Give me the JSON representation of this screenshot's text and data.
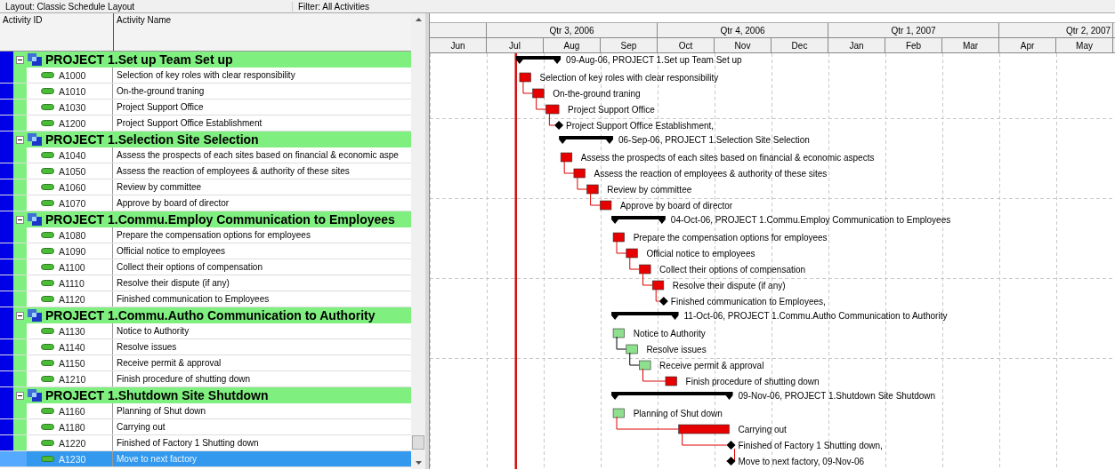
{
  "toolbar": {
    "layout": "Layout: Classic Schedule Layout",
    "filter": "Filter: All Activities"
  },
  "columns": [
    "Activity ID",
    "Activity Name"
  ],
  "timescale": {
    "quarters": [
      "Qtr 3, 2006",
      "Qtr 4, 2006",
      "Qtr 1, 2007",
      "Qtr 2, 2007"
    ],
    "months": [
      "Jun",
      "Jul",
      "Aug",
      "Sep",
      "Oct",
      "Nov",
      "Dec",
      "Jan",
      "Feb",
      "Mar",
      "Apr",
      "May"
    ]
  },
  "groups": [
    {
      "title": "PROJECT 1.Set up  Team Set up",
      "expanded": true,
      "bar_label": "09-Aug-06, PROJECT 1.Set up  Team Set up",
      "activities": [
        {
          "id": "A1000",
          "name": "Selection of key roles with clear responsibility",
          "kind": "task",
          "critical": true,
          "selected": false,
          "bar_label": "Selection of key roles with clear responsibility"
        },
        {
          "id": "A1010",
          "name": "On-the-ground traning",
          "kind": "task",
          "critical": true,
          "selected": false,
          "bar_label": "On-the-ground traning"
        },
        {
          "id": "A1030",
          "name": "Project Support Office",
          "kind": "task",
          "critical": true,
          "selected": false,
          "bar_label": "Project Support Office"
        },
        {
          "id": "A1200",
          "name": "Project Support Office Establishment",
          "kind": "milestone",
          "critical": true,
          "selected": false,
          "bar_label": "Project Support Office Establishment,"
        }
      ]
    },
    {
      "title": "PROJECT 1.Selection  Site Selection",
      "expanded": true,
      "bar_label": "06-Sep-06, PROJECT 1.Selection  Site Selection",
      "activities": [
        {
          "id": "A1040",
          "name": "Assess the prospects of each sites based on financial  & economic aspe",
          "kind": "task",
          "critical": true,
          "selected": false,
          "bar_label": "Assess the prospects of each sites based on financial  & economic aspects"
        },
        {
          "id": "A1050",
          "name": "Assess the reaction of employees & authority of these sites",
          "kind": "task",
          "critical": true,
          "selected": false,
          "bar_label": "Assess the reaction of employees & authority of these sites"
        },
        {
          "id": "A1060",
          "name": "Review by committee",
          "kind": "task",
          "critical": true,
          "selected": false,
          "bar_label": "Review by committee"
        },
        {
          "id": "A1070",
          "name": "Approve by board of director",
          "kind": "task",
          "critical": true,
          "selected": false,
          "bar_label": "Approve by board of director"
        }
      ]
    },
    {
      "title": "PROJECT 1.Commu.Employ  Communication to Employees",
      "expanded": true,
      "bar_label": "04-Oct-06, PROJECT 1.Commu.Employ  Communication to Employees",
      "activities": [
        {
          "id": "A1080",
          "name": "Prepare the compensation options for employees",
          "kind": "task",
          "critical": true,
          "selected": false,
          "bar_label": "Prepare the compensation options for employees"
        },
        {
          "id": "A1090",
          "name": "Official notice to employees",
          "kind": "task",
          "critical": true,
          "selected": false,
          "bar_label": "Official notice to employees"
        },
        {
          "id": "A1100",
          "name": "Collect their options of compensation",
          "kind": "task",
          "critical": true,
          "selected": false,
          "bar_label": "Collect their options of compensation"
        },
        {
          "id": "A1110",
          "name": "Resolve their dispute (if any)",
          "kind": "task",
          "critical": true,
          "selected": false,
          "bar_label": "Resolve their dispute (if any)"
        },
        {
          "id": "A1120",
          "name": "Finished communication to Employees",
          "kind": "milestone",
          "critical": true,
          "selected": false,
          "bar_label": "Finished communication to Employees,"
        }
      ]
    },
    {
      "title": "PROJECT 1.Commu.Autho  Communication to Authority",
      "expanded": true,
      "bar_label": "11-Oct-06, PROJECT 1.Commu.Autho  Communication to Authority",
      "activities": [
        {
          "id": "A1130",
          "name": "Notice to Authority",
          "kind": "task",
          "critical": false,
          "selected": false,
          "bar_label": "Notice to Authority"
        },
        {
          "id": "A1140",
          "name": "Resolve issues",
          "kind": "task",
          "critical": false,
          "selected": false,
          "bar_label": "Resolve issues"
        },
        {
          "id": "A1150",
          "name": "Receive permit & approval",
          "kind": "task",
          "critical": false,
          "selected": false,
          "bar_label": "Receive permit & approval"
        },
        {
          "id": "A1210",
          "name": "Finish procedure of shutting down",
          "kind": "task",
          "critical": true,
          "selected": false,
          "bar_label": "Finish procedure of shutting down"
        }
      ]
    },
    {
      "title": "PROJECT 1.Shutdown  Site Shutdown",
      "expanded": true,
      "bar_label": "09-Nov-06, PROJECT 1.Shutdown  Site Shutdown",
      "activities": [
        {
          "id": "A1160",
          "name": "Planning of Shut down",
          "kind": "task",
          "critical": false,
          "selected": false,
          "bar_label": "Planning of Shut down"
        },
        {
          "id": "A1180",
          "name": "Carrying out",
          "kind": "task",
          "critical": true,
          "selected": false,
          "bar_label": "Carrying out"
        },
        {
          "id": "A1220",
          "name": "Finished of Factory 1 Shutting down",
          "kind": "milestone",
          "critical": true,
          "selected": false,
          "bar_label": "Finished of Factory 1 Shutting down,"
        },
        {
          "id": "A1230",
          "name": "Move to next factory",
          "kind": "milestone",
          "critical": true,
          "selected": true,
          "bar_label": "Move to next factory, 09-Nov-06"
        }
      ]
    }
  ]
}
